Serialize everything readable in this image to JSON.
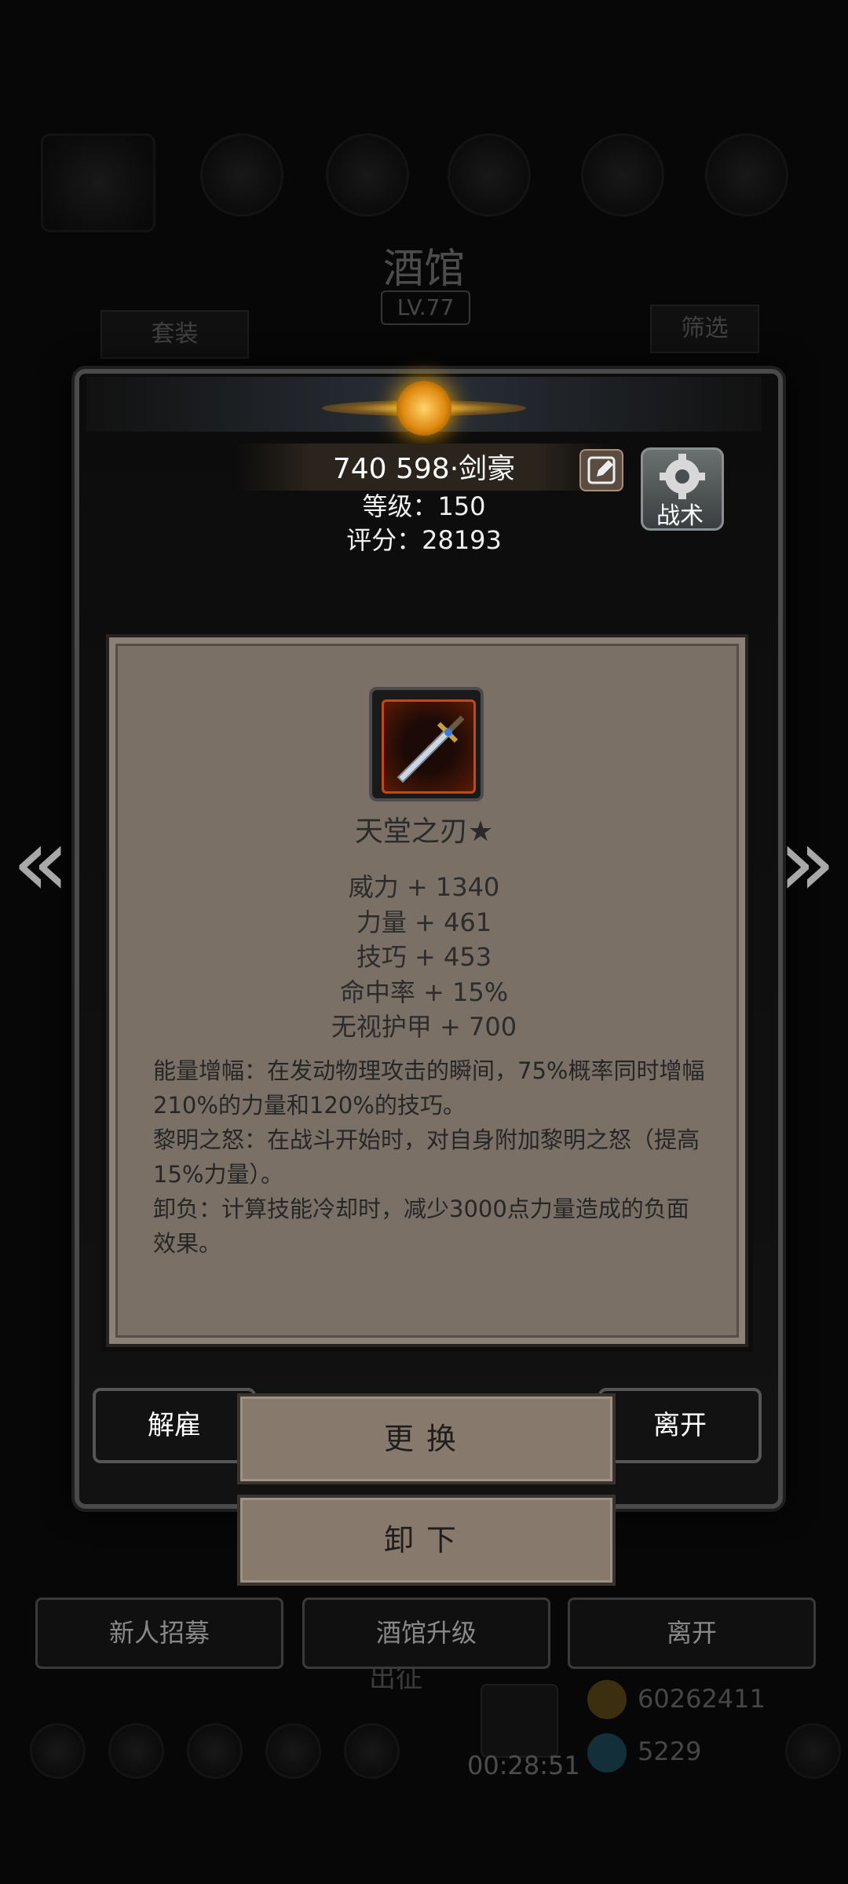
{
  "background": {
    "tavern_title": "酒馆",
    "tavern_level": "LV.77",
    "set_button": "套装",
    "filter_button": "筛选",
    "bottom_buttons": [
      "新人招募",
      "酒馆升级",
      "离开"
    ],
    "expedition_label": "出征",
    "gold_amount": "60262411",
    "gem_amount": "5229",
    "timer": "00:28:51"
  },
  "hero": {
    "name": "740 598·剑豪",
    "level_line": "等级：150",
    "score_line": "评分：28193",
    "tactics_label": "战术"
  },
  "item": {
    "icon": "sword-icon",
    "name": "天堂之刃★",
    "stats": [
      "威力 + 1340",
      "力量 + 461",
      "技巧 + 453",
      "命中率 + 15%",
      "无视护甲 + 700"
    ],
    "descriptions": [
      "能量增幅：在发动物理攻击的瞬间，75%概率同时增幅210%的力量和120%的技巧。",
      "黎明之怒：在战斗开始时，对自身附加黎明之怒（提高15%力量）。",
      "卸负：计算技能冷却时，减少3000点力量造成的负面效果。"
    ]
  },
  "actions": {
    "dismiss": "解雇",
    "replace": "更换",
    "leave": "离开",
    "unequip": "卸下"
  },
  "colors": {
    "popup_bg": "#7a7066",
    "icon_border": "#c24a12",
    "emblem": "#e08a10"
  }
}
